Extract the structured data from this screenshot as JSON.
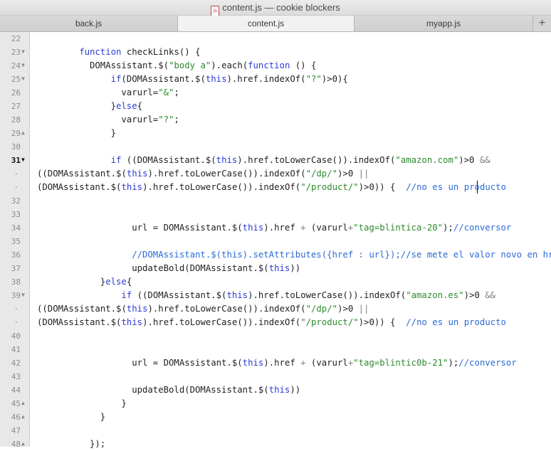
{
  "window": {
    "title": "content.js — cookie blockers",
    "file_icon_label": "js"
  },
  "tabs": [
    {
      "label": "back.js",
      "active": false
    },
    {
      "label": "content.js",
      "active": true
    },
    {
      "label": "myapp.js",
      "active": false
    }
  ],
  "new_tab_label": "+",
  "gutter": [
    {
      "num": "22",
      "fold": ""
    },
    {
      "num": "23",
      "fold": "▼"
    },
    {
      "num": "24",
      "fold": "▼"
    },
    {
      "num": "25",
      "fold": "▼"
    },
    {
      "num": "26",
      "fold": ""
    },
    {
      "num": "27",
      "fold": ""
    },
    {
      "num": "28",
      "fold": ""
    },
    {
      "num": "29",
      "fold": "▲"
    },
    {
      "num": "30",
      "fold": ""
    },
    {
      "num": "31",
      "fold": "▼",
      "current": true
    },
    {
      "num": "·",
      "fold": "",
      "cont": true
    },
    {
      "num": "·",
      "fold": "",
      "cont": true
    },
    {
      "num": "32",
      "fold": ""
    },
    {
      "num": "33",
      "fold": ""
    },
    {
      "num": "34",
      "fold": ""
    },
    {
      "num": "35",
      "fold": ""
    },
    {
      "num": "36",
      "fold": ""
    },
    {
      "num": "37",
      "fold": ""
    },
    {
      "num": "38",
      "fold": ""
    },
    {
      "num": "39",
      "fold": "▼"
    },
    {
      "num": "·",
      "fold": "",
      "cont": true
    },
    {
      "num": "·",
      "fold": "",
      "cont": true
    },
    {
      "num": "40",
      "fold": ""
    },
    {
      "num": "41",
      "fold": ""
    },
    {
      "num": "42",
      "fold": ""
    },
    {
      "num": "43",
      "fold": ""
    },
    {
      "num": "44",
      "fold": ""
    },
    {
      "num": "45",
      "fold": "▲"
    },
    {
      "num": "46",
      "fold": "▲"
    },
    {
      "num": "47",
      "fold": ""
    },
    {
      "num": "48",
      "fold": "▲"
    }
  ],
  "code_lines": [
    {
      "indent": 0,
      "tokens": []
    },
    {
      "indent": 4,
      "tokens": [
        [
          "kw",
          "function"
        ],
        [
          "p",
          " checkLinks() {"
        ]
      ]
    },
    {
      "indent": 5,
      "tokens": [
        [
          "p",
          "DOMAssistant.$("
        ],
        [
          "str",
          "\"body a\""
        ],
        [
          "p",
          ").each("
        ],
        [
          "kw",
          "function"
        ],
        [
          "p",
          " () {"
        ]
      ]
    },
    {
      "indent": 7,
      "tokens": [
        [
          "kw",
          "if"
        ],
        [
          "p",
          "(DOMAssistant.$("
        ],
        [
          "kw",
          "this"
        ],
        [
          "p",
          ").href.indexOf("
        ],
        [
          "str",
          "\"?\""
        ],
        [
          "p",
          ")>0){"
        ]
      ]
    },
    {
      "indent": 8,
      "tokens": [
        [
          "p",
          "varurl="
        ],
        [
          "str",
          "\"&\""
        ],
        [
          "p",
          ";"
        ]
      ]
    },
    {
      "indent": 7,
      "tokens": [
        [
          "p",
          "}"
        ],
        [
          "kw",
          "else"
        ],
        [
          "p",
          "{"
        ]
      ]
    },
    {
      "indent": 8,
      "tokens": [
        [
          "p",
          "varurl="
        ],
        [
          "str",
          "\"?\""
        ],
        [
          "p",
          ";"
        ]
      ]
    },
    {
      "indent": 7,
      "tokens": [
        [
          "p",
          "}"
        ]
      ]
    },
    {
      "indent": 0,
      "tokens": []
    },
    {
      "indent": 7,
      "tokens": [
        [
          "kw",
          "if"
        ],
        [
          "p",
          " ((DOMAssistant.$("
        ],
        [
          "kw",
          "this"
        ],
        [
          "p",
          ").href.toLowerCase()).indexOf("
        ],
        [
          "str",
          "\"amazon.com\""
        ],
        [
          "p",
          ")>0 "
        ],
        [
          "op",
          "&&"
        ]
      ]
    },
    {
      "indent": 0,
      "tokens": [
        [
          "p",
          "((DOMAssistant.$("
        ],
        [
          "kw",
          "this"
        ],
        [
          "p",
          ").href.toLowerCase()).indexOf("
        ],
        [
          "str",
          "\"/dp/\""
        ],
        [
          "p",
          ")>0 "
        ],
        [
          "op",
          "||"
        ]
      ]
    },
    {
      "indent": 0,
      "tokens": [
        [
          "p",
          "(DOMAssistant.$("
        ],
        [
          "kw",
          "this"
        ],
        [
          "p",
          ").href.toLowerCase()).indexOf("
        ],
        [
          "str",
          "\"/product/\""
        ],
        [
          "p",
          ")>0)) {  "
        ],
        [
          "cm",
          "//no es un producto"
        ]
      ]
    },
    {
      "indent": 0,
      "tokens": []
    },
    {
      "indent": 0,
      "tokens": []
    },
    {
      "indent": 9,
      "tokens": [
        [
          "p",
          "url = DOMAssistant.$("
        ],
        [
          "kw",
          "this"
        ],
        [
          "p",
          ").href "
        ],
        [
          "op",
          "+"
        ],
        [
          "p",
          " (varurl"
        ],
        [
          "op",
          "+"
        ],
        [
          "str",
          "\"tag=blintica-20\""
        ],
        [
          "p",
          ");"
        ],
        [
          "cm",
          "//conversor"
        ]
      ]
    },
    {
      "indent": 0,
      "tokens": []
    },
    {
      "indent": 9,
      "tokens": [
        [
          "cm",
          "//DOMAssistant.$(this).setAttributes({href : url});//se mete el valor novo en href"
        ]
      ]
    },
    {
      "indent": 9,
      "tokens": [
        [
          "p",
          "updateBold(DOMAssistant.$("
        ],
        [
          "kw",
          "this"
        ],
        [
          "p",
          "))"
        ]
      ]
    },
    {
      "indent": 6,
      "tokens": [
        [
          "p",
          "}"
        ],
        [
          "kw",
          "else"
        ],
        [
          "p",
          "{"
        ]
      ]
    },
    {
      "indent": 8,
      "tokens": [
        [
          "kw",
          "if"
        ],
        [
          "p",
          " ((DOMAssistant.$("
        ],
        [
          "kw",
          "this"
        ],
        [
          "p",
          ").href.toLowerCase()).indexOf("
        ],
        [
          "str",
          "\"amazon.es\""
        ],
        [
          "p",
          ")>0 "
        ],
        [
          "op",
          "&&"
        ]
      ]
    },
    {
      "indent": 0,
      "tokens": [
        [
          "p",
          "((DOMAssistant.$("
        ],
        [
          "kw",
          "this"
        ],
        [
          "p",
          ").href.toLowerCase()).indexOf("
        ],
        [
          "str",
          "\"/dp/\""
        ],
        [
          "p",
          ")>0 "
        ],
        [
          "op",
          "||"
        ]
      ]
    },
    {
      "indent": 0,
      "tokens": [
        [
          "p",
          "(DOMAssistant.$("
        ],
        [
          "kw",
          "this"
        ],
        [
          "p",
          ").href.toLowerCase()).indexOf("
        ],
        [
          "str",
          "\"/product/\""
        ],
        [
          "p",
          ")>0)) {  "
        ],
        [
          "cm",
          "//no es un producto"
        ]
      ]
    },
    {
      "indent": 0,
      "tokens": []
    },
    {
      "indent": 0,
      "tokens": []
    },
    {
      "indent": 9,
      "tokens": [
        [
          "p",
          "url = DOMAssistant.$("
        ],
        [
          "kw",
          "this"
        ],
        [
          "p",
          ").href "
        ],
        [
          "op",
          "+"
        ],
        [
          "p",
          " (varurl"
        ],
        [
          "op",
          "+"
        ],
        [
          "str",
          "\"tag=blintic0b-21\""
        ],
        [
          "p",
          ");"
        ],
        [
          "cm",
          "//conversor"
        ]
      ]
    },
    {
      "indent": 0,
      "tokens": []
    },
    {
      "indent": 9,
      "tokens": [
        [
          "p",
          "updateBold(DOMAssistant.$("
        ],
        [
          "kw",
          "this"
        ],
        [
          "p",
          "))"
        ]
      ]
    },
    {
      "indent": 8,
      "tokens": [
        [
          "p",
          "}"
        ]
      ]
    },
    {
      "indent": 6,
      "tokens": [
        [
          "p",
          "}"
        ]
      ]
    },
    {
      "indent": 0,
      "tokens": []
    },
    {
      "indent": 5,
      "tokens": [
        [
          "p",
          "});"
        ]
      ]
    }
  ],
  "colors": {
    "keyword": "#2b3ad6",
    "string": "#2d8a2d",
    "comment": "#2a6bd6",
    "operator": "#808080",
    "text": "#1f1f1f"
  }
}
